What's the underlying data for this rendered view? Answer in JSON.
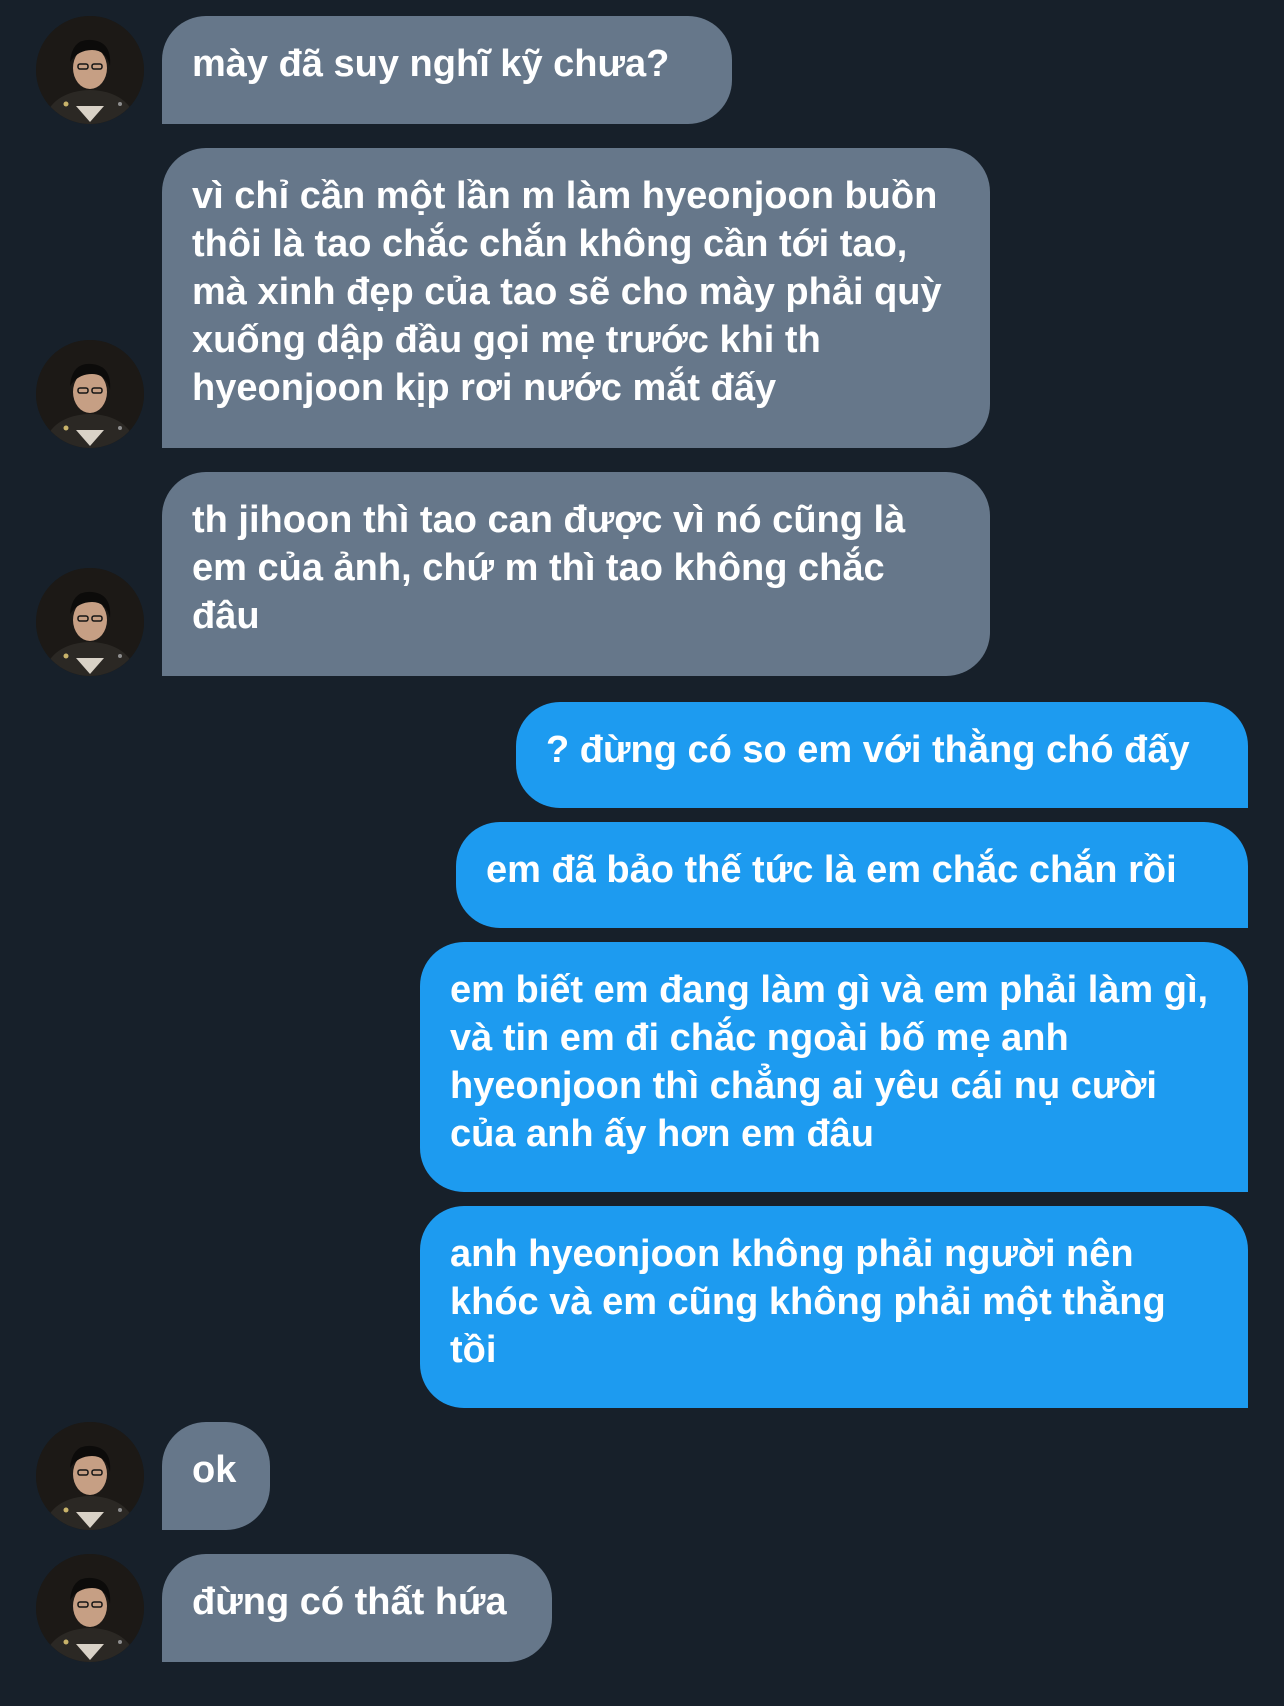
{
  "conversation": {
    "messages": [
      {
        "direction": "incoming",
        "text": "mày đã suy nghĩ kỹ chưa?"
      },
      {
        "direction": "incoming",
        "text": "vì chỉ cần một lần m làm hyeonjoon buồn thôi là tao chắc chắn không cần tới tao, mà xinh đẹp của tao sẽ cho mày phải quỳ xuống dập đầu gọi mẹ trước khi th hyeonjoon kịp rơi nước mắt đấy"
      },
      {
        "direction": "incoming",
        "text": "th jihoon thì tao can được vì nó cũng là em của ảnh, chứ m thì tao không chắc đâu"
      },
      {
        "direction": "outgoing",
        "text": "? đừng có so em với thằng chó đấy"
      },
      {
        "direction": "outgoing",
        "text": "em đã bảo thế tức là em chắc chắn rồi"
      },
      {
        "direction": "outgoing",
        "text": "em biết em đang làm gì và em phải làm gì, và tin em đi chắc ngoài bố mẹ anh hyeonjoon thì chẳng ai yêu cái nụ cười của anh ấy hơn em đâu"
      },
      {
        "direction": "outgoing",
        "text": "anh hyeonjoon không phải người nên khóc và em cũng không phải một thằng tồi"
      },
      {
        "direction": "incoming",
        "text": "ok"
      },
      {
        "direction": "incoming",
        "text": "đừng có thất hứa"
      }
    ]
  },
  "colors": {
    "background": "#17202a",
    "incoming_bubble": "#66778a",
    "outgoing_bubble": "#1d9bf0",
    "text": "#ffffff"
  },
  "icons": {
    "avatar": "contact-avatar-photo"
  }
}
